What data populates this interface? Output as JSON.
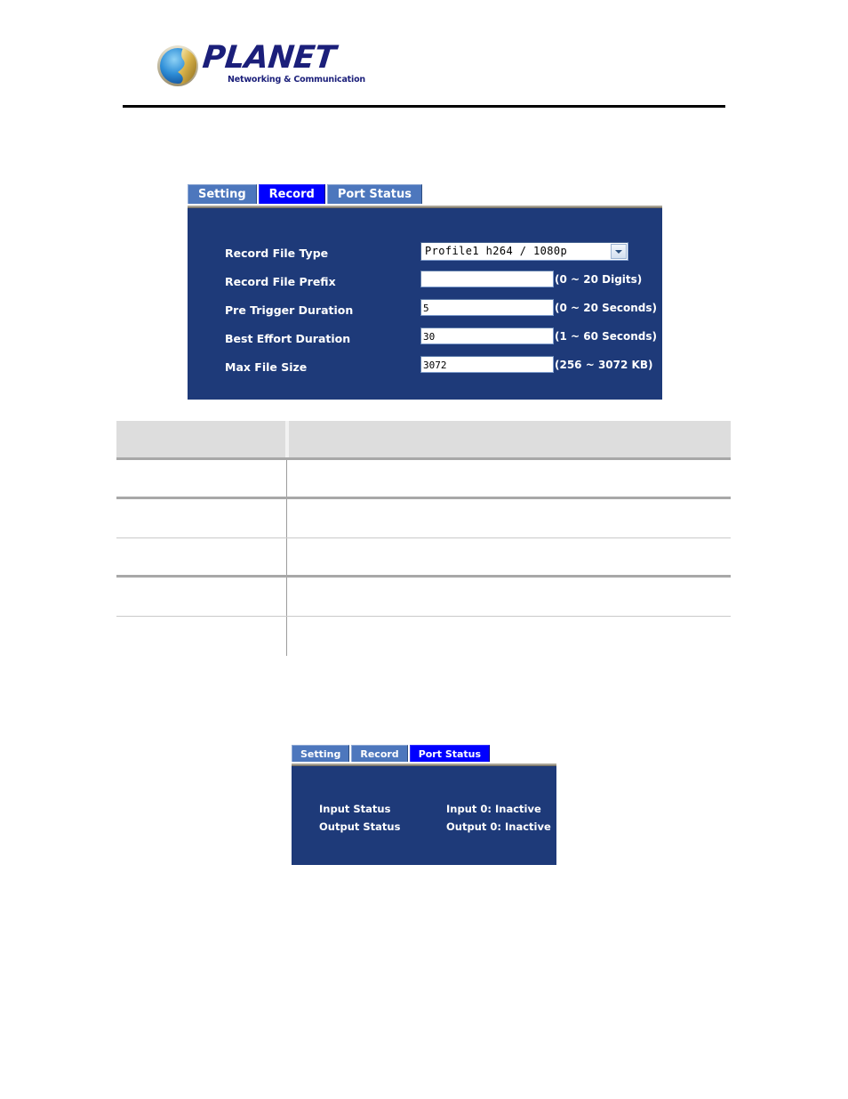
{
  "header": {
    "logo_word": "PLANET",
    "logo_tagline": "Networking & Communication",
    "globe_icon": "planet-globe-icon"
  },
  "record_panel": {
    "tabs": [
      {
        "label": "Setting",
        "active": false
      },
      {
        "label": "Record",
        "active": true
      },
      {
        "label": "Port Status",
        "active": false
      }
    ],
    "fields": [
      {
        "label": "Record File Type",
        "type": "select",
        "value": "Profile1 h264 / 1080p",
        "hint": ""
      },
      {
        "label": "Record File Prefix",
        "type": "text",
        "value": "",
        "hint": "(0 ~ 20 Digits)"
      },
      {
        "label": "Pre Trigger Duration",
        "type": "text",
        "value": "5",
        "hint": "(0 ~ 20 Seconds)"
      },
      {
        "label": "Best Effort Duration",
        "type": "text",
        "value": "30",
        "hint": "(1 ~ 60 Seconds)"
      },
      {
        "label": "Max File Size",
        "type": "text",
        "value": "3072",
        "hint": "(256 ~ 3072 KB)"
      }
    ]
  },
  "description_table": {
    "headers": [
      "",
      ""
    ],
    "rows": [
      [
        "",
        ""
      ],
      [
        "",
        ""
      ],
      [
        "",
        ""
      ],
      [
        "",
        ""
      ],
      [
        "",
        ""
      ]
    ]
  },
  "port_panel": {
    "tabs": [
      {
        "label": "Setting",
        "active": false
      },
      {
        "label": "Record",
        "active": false
      },
      {
        "label": "Port Status",
        "active": true
      }
    ],
    "rows": [
      {
        "label": "Input Status",
        "value": "Input 0: Inactive"
      },
      {
        "label": "Output Status",
        "value": "Output 0: Inactive"
      }
    ]
  },
  "colors": {
    "panel_body": "#1e3a79",
    "tab_active": "#0000ff",
    "tab_inactive": "#4d77bd",
    "brand_navy": "#1b1f7a",
    "table_header": "#dddddd"
  }
}
